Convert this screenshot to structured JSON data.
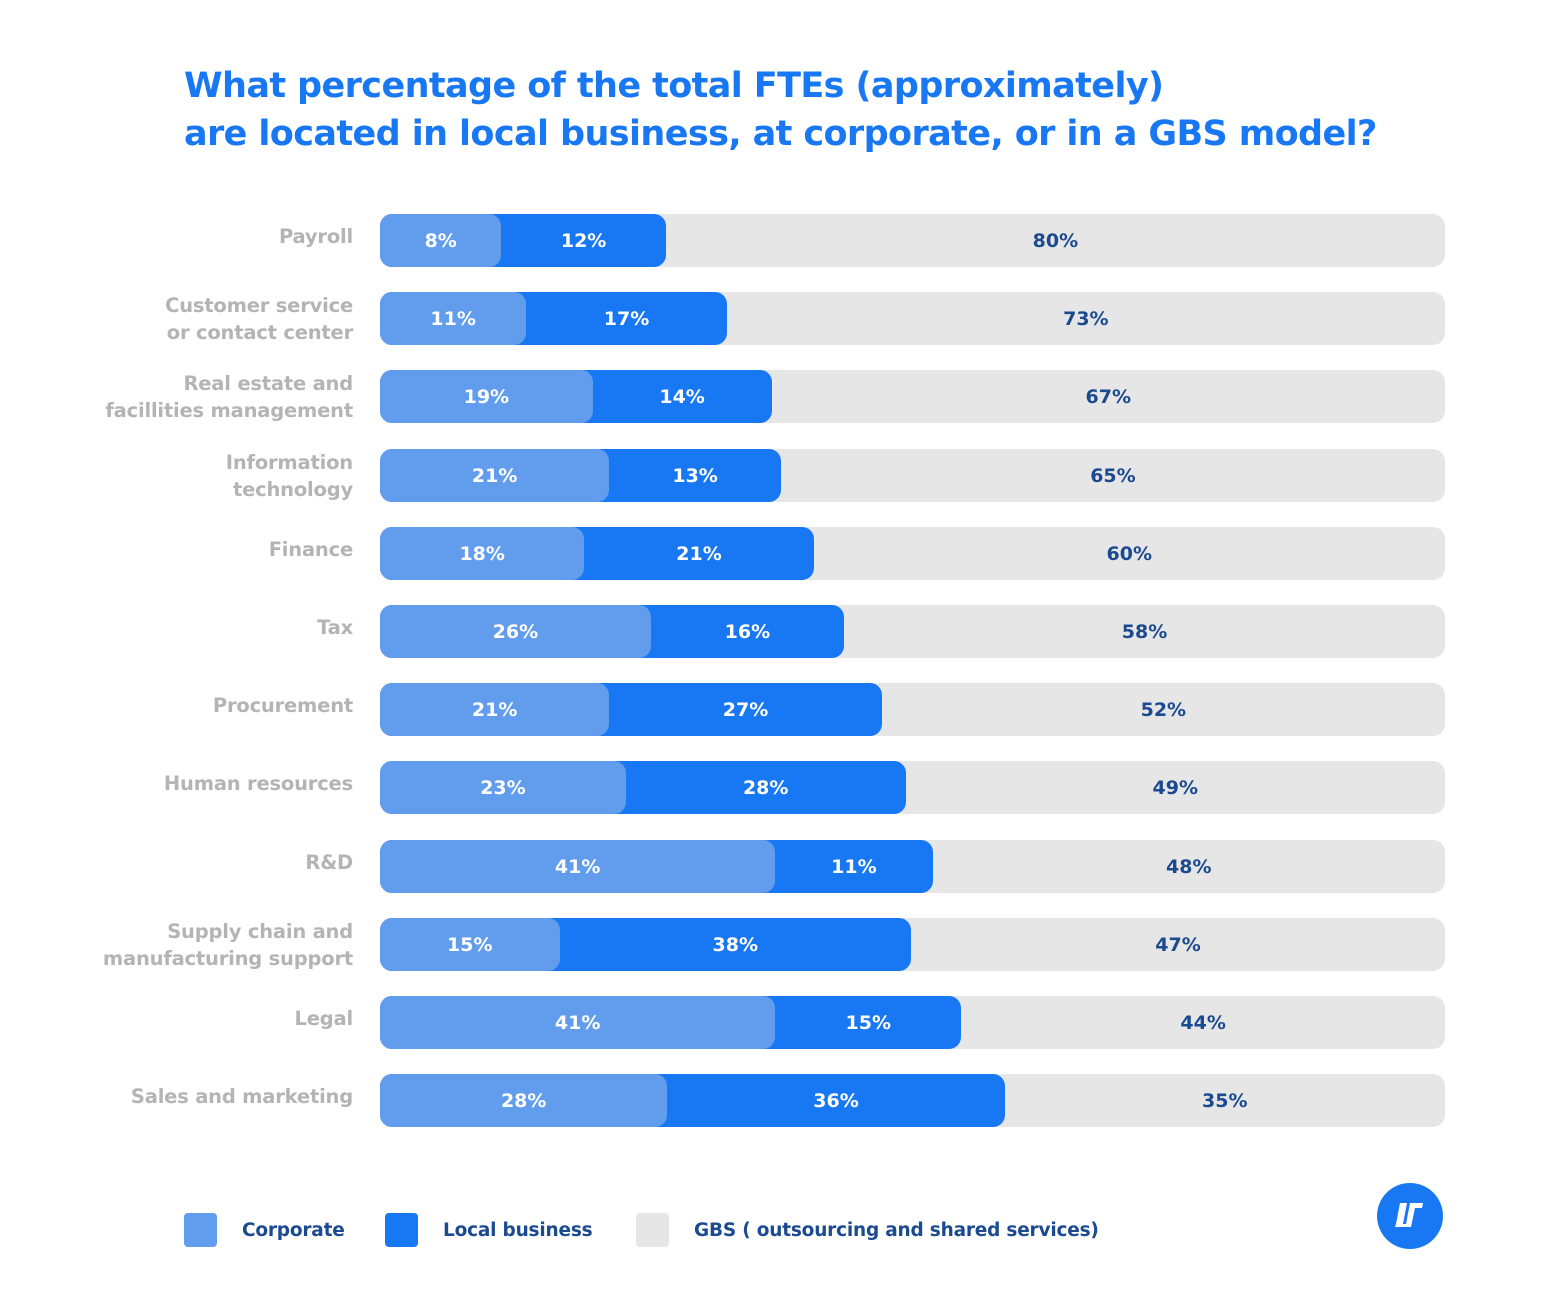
{
  "colors": {
    "title": "#1877f2",
    "category_label": "#b4b4b4",
    "corporate": "#629ded",
    "local_business": "#1877f2",
    "gbs": "#e6e6e6",
    "gbs_value_text": "#1b4a90",
    "legend_text": "#1b4a90",
    "logo_bg": "#1877f2"
  },
  "header": {
    "title_line1": "What percentage of the total FTEs (approximately)",
    "title_line2": "are located in local business, at corporate, or in a GBS model?"
  },
  "legend": {
    "placement": "bottom-left",
    "items": [
      {
        "key": "corporate",
        "label": "Corporate"
      },
      {
        "key": "local_business",
        "label": "Local business"
      },
      {
        "key": "gbs",
        "label": "GBS ( outsourcing and shared services)"
      }
    ]
  },
  "logo": {
    "icon": "brand-logo-icon"
  },
  "chart_data": {
    "type": "bar",
    "orientation": "horizontal",
    "stacked": true,
    "title": "What percentage of the total FTEs (approximately) are located in local business, at corporate, or in a GBS model?",
    "xlabel": "",
    "ylabel": "",
    "xlim": [
      0,
      100
    ],
    "grid": false,
    "legend_position": "bottom-left",
    "unit": "%",
    "categories": [
      "Payroll",
      "Customer service\nor contact center",
      "Real estate and\nfacillities management",
      "Information\ntechnology",
      "Finance",
      "Tax",
      "Procurement",
      "Human resources",
      "R&D",
      "Supply chain and\nmanufacturing support",
      "Legal",
      "Sales and marketing"
    ],
    "series": [
      {
        "name": "Corporate",
        "key": "corporate",
        "values": [
          8,
          11,
          19,
          21,
          18,
          26,
          21,
          23,
          41,
          15,
          41,
          28
        ]
      },
      {
        "name": "Local business",
        "key": "local_business",
        "values": [
          12,
          17,
          14,
          13,
          21,
          16,
          27,
          28,
          11,
          38,
          15,
          36
        ]
      },
      {
        "name": "GBS ( outsourcing and shared services)",
        "key": "gbs",
        "values": [
          80,
          73,
          67,
          65,
          60,
          58,
          52,
          49,
          48,
          47,
          44,
          35
        ]
      }
    ],
    "value_labels": [
      [
        "8%",
        "12%",
        "80%"
      ],
      [
        "11%",
        "17%",
        "73%"
      ],
      [
        "19%",
        "14%",
        "67%"
      ],
      [
        "21%",
        "13%",
        "65%"
      ],
      [
        "18%",
        "21%",
        "60%"
      ],
      [
        "26%",
        "16%",
        "58%"
      ],
      [
        "21%",
        "27%",
        "52%"
      ],
      [
        "23%",
        "28%",
        "49%"
      ],
      [
        "41%",
        "11%",
        "48%"
      ],
      [
        "15%",
        "38%",
        "47%"
      ],
      [
        "41%",
        "15%",
        "44%"
      ],
      [
        "28%",
        "36%",
        "35%"
      ]
    ]
  }
}
